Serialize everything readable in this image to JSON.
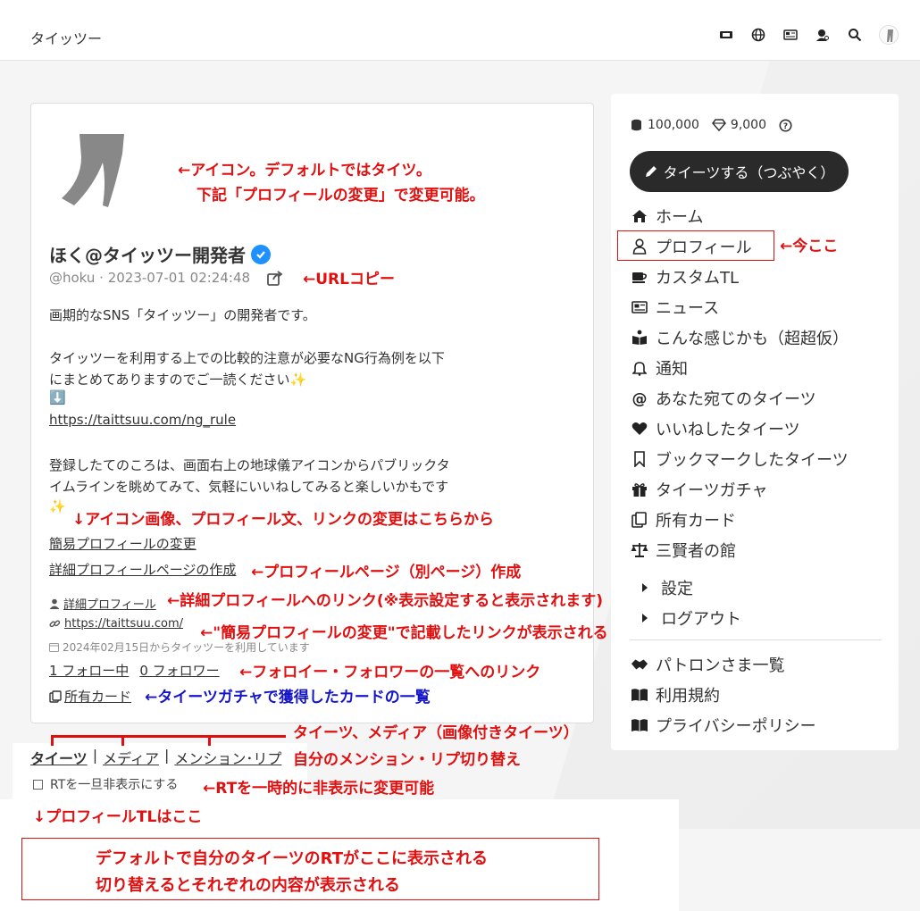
{
  "app": {
    "title": "タイッツー"
  },
  "profile": {
    "name": "ほく@タイッツー開発者",
    "handle_line": "@hoku · 2023-07-01 02:24:48",
    "bio_line1": "画期的なSNS「タイッツー」の開発者です。",
    "bio_line2": "タイッツーを利用する上での比較的注意が必要なNG行為例を以下",
    "bio_line3": "にまとめてありますのでご一読ください✨",
    "bio_line4": "⬇️",
    "bio_link": "https://taittsuu.com/ng_rule",
    "bio_line5": "登録したてのころは、画面右上の地球儀アイコンからパブリックタ",
    "bio_line6": "イムラインを眺めてみて、気軽にいいねしてみると楽しいかもです",
    "bio_line7": "✨",
    "edit_simple": "簡易プロフィールの変更",
    "edit_detail": "詳細プロフィールページの作成",
    "detail_link": "詳細プロフィール",
    "url_link": "https://taittsuu.com/",
    "since": "2024年02月15日からタイッツーを利用しています",
    "following": "1 フォロー中",
    "followers": "0 フォロワー",
    "cards": "所有カード"
  },
  "tabs": {
    "posts": "タイーツ",
    "sep1": "|",
    "media": "メディア",
    "sep2": "|",
    "mentions": "メンション･リプ"
  },
  "rt_toggle": "RTを一旦非表示にする",
  "sidebar": {
    "coins": "100,000",
    "gems": "9,000",
    "post_button": "タイーツする（つぶやく）",
    "nav": [
      {
        "label": "ホーム",
        "icon": "home-icon"
      },
      {
        "label": "プロフィール",
        "icon": "user-icon"
      },
      {
        "label": "カスタムTL",
        "icon": "cup-icon"
      },
      {
        "label": "ニュース",
        "icon": "newspaper-icon"
      },
      {
        "label": "こんな感じかも（超超仮）",
        "icon": "book-reader-icon"
      },
      {
        "label": "通知",
        "icon": "bell-icon"
      },
      {
        "label": "あなた宛てのタイーツ",
        "icon": "at-icon"
      },
      {
        "label": "いいねしたタイーツ",
        "icon": "heart-icon"
      },
      {
        "label": "ブックマークしたタイーツ",
        "icon": "bookmark-icon"
      },
      {
        "label": "タイーツガチャ",
        "icon": "gift-icon"
      },
      {
        "label": "所有カード",
        "icon": "cards-icon"
      },
      {
        "label": "三賢者の館",
        "icon": "scale-icon"
      },
      {
        "label": "設定",
        "icon": "caret-right-icon"
      },
      {
        "label": "ログアウト",
        "icon": "caret-right-icon"
      },
      {
        "label": "パトロンさま一覧",
        "icon": "handshake-icon"
      },
      {
        "label": "利用規約",
        "icon": "book-icon"
      },
      {
        "label": "プライバシーポリシー",
        "icon": "book-icon"
      }
    ]
  },
  "annotations": {
    "icon_note1": "←アイコン。デフォルトではタイツ。",
    "icon_note2": "下記「プロフィールの変更」で変更可能。",
    "url_copy": "←URLコピー",
    "now_here": "←今ここ",
    "change_note": "↓アイコン画像、プロフィール文、リンクの変更はこちらから",
    "profile_page": "←プロフィールページ（別ページ）作成",
    "detail_link": "←詳細プロフィールへのリンク(※表示設定すると表示されます)",
    "link_note": "←\"簡易プロフィールの変更\"で記載したリンクが表示される",
    "follow_note": "←フォロイー・フォロワーの一覧へのリンク",
    "cards_note": "←タイーツガチャで獲得したカードの一覧",
    "tabs_note1": "タイーツ、メディア（画像付きタイーツ）",
    "tabs_note2": "自分のメンション・リプ切り替え",
    "rt_note": "←RTを一時的に非表示に変更可能",
    "tl_note": "↓プロフィールTLはここ",
    "box_line1": "デフォルトで自分のタイーツのRTがここに表示される",
    "box_line2": "切り替えるとそれぞれの内容が表示される"
  },
  "colors": {
    "annotation": "#e01010",
    "annotation_blue": "#1515c8",
    "verified": "#1e90ff",
    "post_button": "#2a2a2a"
  }
}
